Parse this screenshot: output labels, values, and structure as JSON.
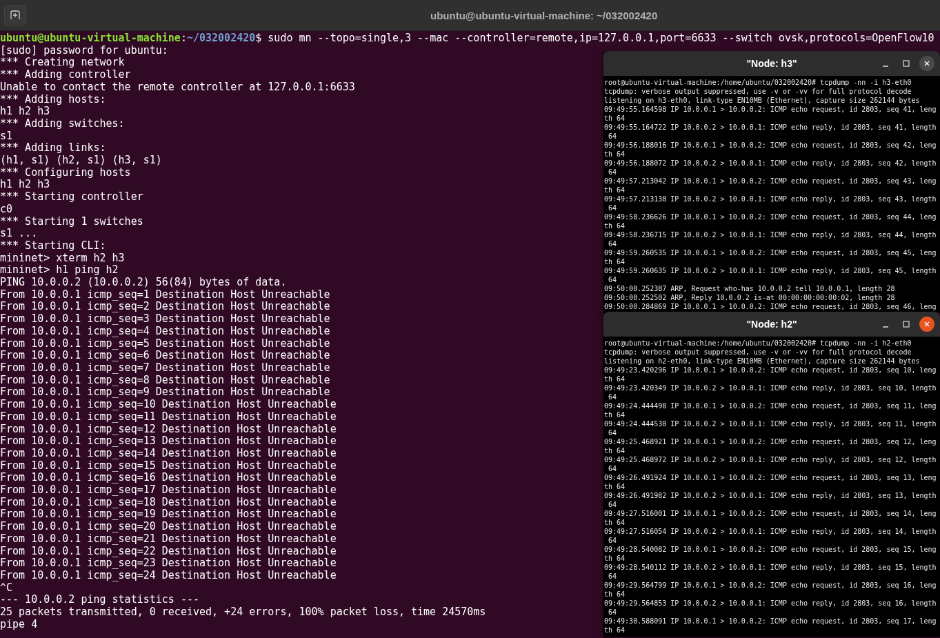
{
  "header": {
    "title": "ubuntu@ubuntu-virtual-machine: ~/032002420"
  },
  "terminal": {
    "prompt": {
      "user": "ubuntu@ubuntu-virtual-machine",
      "separator": ":",
      "path": "~/032002420",
      "command": "$ sudo mn --topo=single,3 --mac --controller=remote,ip=127.0.0.1,port=6633 --switch ovsk,protocols=OpenFlow10"
    },
    "lines": [
      "[sudo] password for ubuntu:",
      "*** Creating network",
      "*** Adding controller",
      "Unable to contact the remote controller at 127.0.0.1:6633",
      "*** Adding hosts:",
      "h1 h2 h3",
      "*** Adding switches:",
      "s1",
      "*** Adding links:",
      "(h1, s1) (h2, s1) (h3, s1)",
      "*** Configuring hosts",
      "h1 h2 h3",
      "*** Starting controller",
      "c0",
      "*** Starting 1 switches",
      "s1 ...",
      "*** Starting CLI:",
      "mininet> xterm h2 h3",
      "mininet> h1 ping h2",
      "PING 10.0.0.2 (10.0.0.2) 56(84) bytes of data.",
      "From 10.0.0.1 icmp_seq=1 Destination Host Unreachable",
      "From 10.0.0.1 icmp_seq=2 Destination Host Unreachable",
      "From 10.0.0.1 icmp_seq=3 Destination Host Unreachable",
      "From 10.0.0.1 icmp_seq=4 Destination Host Unreachable",
      "From 10.0.0.1 icmp_seq=5 Destination Host Unreachable",
      "From 10.0.0.1 icmp_seq=6 Destination Host Unreachable",
      "From 10.0.0.1 icmp_seq=7 Destination Host Unreachable",
      "From 10.0.0.1 icmp_seq=8 Destination Host Unreachable",
      "From 10.0.0.1 icmp_seq=9 Destination Host Unreachable",
      "From 10.0.0.1 icmp_seq=10 Destination Host Unreachable",
      "From 10.0.0.1 icmp_seq=11 Destination Host Unreachable",
      "From 10.0.0.1 icmp_seq=12 Destination Host Unreachable",
      "From 10.0.0.1 icmp_seq=13 Destination Host Unreachable",
      "From 10.0.0.1 icmp_seq=14 Destination Host Unreachable",
      "From 10.0.0.1 icmp_seq=15 Destination Host Unreachable",
      "From 10.0.0.1 icmp_seq=16 Destination Host Unreachable",
      "From 10.0.0.1 icmp_seq=17 Destination Host Unreachable",
      "From 10.0.0.1 icmp_seq=18 Destination Host Unreachable",
      "From 10.0.0.1 icmp_seq=19 Destination Host Unreachable",
      "From 10.0.0.1 icmp_seq=20 Destination Host Unreachable",
      "From 10.0.0.1 icmp_seq=21 Destination Host Unreachable",
      "From 10.0.0.1 icmp_seq=22 Destination Host Unreachable",
      "From 10.0.0.1 icmp_seq=23 Destination Host Unreachable",
      "From 10.0.0.1 icmp_seq=24 Destination Host Unreachable",
      "^C",
      "--- 10.0.0.2 ping statistics ---",
      "25 packets transmitted, 0 received, +24 errors, 100% packet loss, time 24570ms",
      "pipe 4"
    ]
  },
  "xterm_windows": [
    {
      "title": "\"Node: h3\"",
      "focused": false,
      "lines": [
        "root@ubuntu-virtual-machine:/home/ubuntu/032002420# tcpdump -nn -i h3-eth0",
        "tcpdump: verbose output suppressed, use -v or -vv for full protocol decode",
        "listening on h3-eth0, link-type EN10MB (Ethernet), capture size 262144 bytes",
        "09:49:55.164598 IP 10.0.0.1 > 10.0.0.2: ICMP echo request, id 2803, seq 41, leng",
        "th 64",
        "09:49:55.164722 IP 10.0.0.2 > 10.0.0.1: ICMP echo reply, id 2803, seq 41, length",
        " 64",
        "09:49:56.188016 IP 10.0.0.1 > 10.0.0.2: ICMP echo request, id 2803, seq 42, leng",
        "th 64",
        "09:49:56.188072 IP 10.0.0.2 > 10.0.0.1: ICMP echo reply, id 2803, seq 42, length",
        " 64",
        "09:49:57.213042 IP 10.0.0.1 > 10.0.0.2: ICMP echo request, id 2803, seq 43, leng",
        "th 64",
        "09:49:57.213138 IP 10.0.0.2 > 10.0.0.1: ICMP echo reply, id 2803, seq 43, length",
        " 64",
        "09:49:58.236626 IP 10.0.0.1 > 10.0.0.2: ICMP echo request, id 2803, seq 44, leng",
        "th 64",
        "09:49:58.236715 IP 10.0.0.2 > 10.0.0.1: ICMP echo reply, id 2803, seq 44, length",
        " 64",
        "09:49:59.260535 IP 10.0.0.1 > 10.0.0.2: ICMP echo request, id 2803, seq 45, leng",
        "th 64",
        "09:49:59.260635 IP 10.0.0.2 > 10.0.0.1: ICMP echo reply, id 2803, seq 45, length",
        " 64",
        "09:50:00.252387 ARP, Request who-has 10.0.0.2 tell 10.0.0.1, length 28",
        "09:50:00.252502 ARP, Reply 10.0.0.2 is-at 00:00:00:00:00:02, length 28",
        "09:50:00.284869 IP 10.0.0.1 > 10.0.0.2: ICMP echo request, id 2803, seq 46, leng"
      ]
    },
    {
      "title": "\"Node: h2\"",
      "focused": true,
      "lines": [
        "root@ubuntu-virtual-machine:/home/ubuntu/032002420# tcpdump -nn -i h2-eth0",
        "tcpdump: verbose output suppressed, use -v or -vv for full protocol decode",
        "listening on h2-eth0, link-type EN10MB (Ethernet), capture size 262144 bytes",
        "09:49:23.420296 IP 10.0.0.1 > 10.0.0.2: ICMP echo request, id 2803, seq 10, leng",
        "th 64",
        "09:49:23.420349 IP 10.0.0.2 > 10.0.0.1: ICMP echo reply, id 2803, seq 10, length",
        " 64",
        "09:49:24.444498 IP 10.0.0.1 > 10.0.0.2: ICMP echo request, id 2803, seq 11, leng",
        "th 64",
        "09:49:24.444530 IP 10.0.0.2 > 10.0.0.1: ICMP echo reply, id 2803, seq 11, length",
        " 64",
        "09:49:25.468921 IP 10.0.0.1 > 10.0.0.2: ICMP echo request, id 2803, seq 12, leng",
        "th 64",
        "09:49:25.468972 IP 10.0.0.2 > 10.0.0.1: ICMP echo reply, id 2803, seq 12, length",
        " 64",
        "09:49:26.491924 IP 10.0.0.1 > 10.0.0.2: ICMP echo request, id 2803, seq 13, leng",
        "th 64",
        "09:49:26.491982 IP 10.0.0.2 > 10.0.0.1: ICMP echo reply, id 2803, seq 13, length",
        " 64",
        "09:49:27.516001 IP 10.0.0.1 > 10.0.0.2: ICMP echo request, id 2803, seq 14, leng",
        "th 64",
        "09:49:27.516054 IP 10.0.0.2 > 10.0.0.1: ICMP echo reply, id 2803, seq 14, length",
        " 64",
        "09:49:28.540082 IP 10.0.0.1 > 10.0.0.2: ICMP echo request, id 2803, seq 15, leng",
        "th 64",
        "09:49:28.540112 IP 10.0.0.2 > 10.0.0.1: ICMP echo reply, id 2803, seq 15, length",
        " 64",
        "09:49:29.564799 IP 10.0.0.1 > 10.0.0.2: ICMP echo request, id 2803, seq 16, leng",
        "th 64",
        "09:49:29.564853 IP 10.0.0.2 > 10.0.0.1: ICMP echo reply, id 2803, seq 16, length",
        " 64",
        "09:49:30.588091 IP 10.0.0.1 > 10.0.0.2: ICMP echo request, id 2803, seq 17, leng",
        "th 64"
      ]
    }
  ]
}
